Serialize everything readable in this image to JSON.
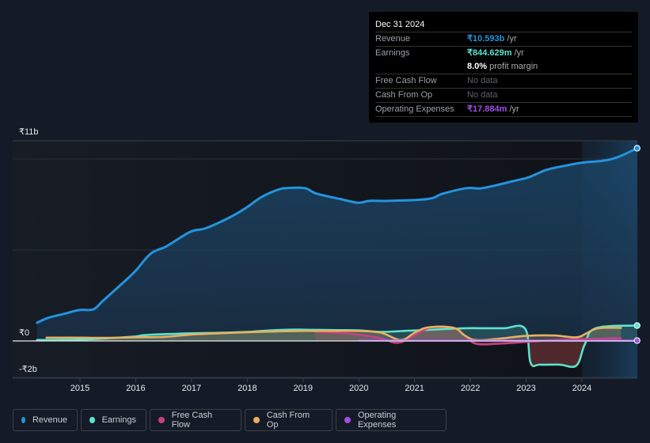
{
  "tooltip": {
    "date": "Dec 31 2024",
    "rows": [
      {
        "label": "Revenue",
        "value": "₹10.593b",
        "unit": " /yr",
        "color": "#2394df"
      },
      {
        "label": "Earnings",
        "value": "₹844.629m",
        "unit": " /yr",
        "color": "#5ce3cc"
      },
      {
        "label": "",
        "value": "8.0%",
        "unit": " profit margin",
        "color": "#ffffff"
      },
      {
        "label": "Free Cash Flow",
        "value": "No data",
        "unit": "",
        "color": ""
      },
      {
        "label": "Cash From Op",
        "value": "No data",
        "unit": "",
        "color": ""
      },
      {
        "label": "Operating Expenses",
        "value": "₹17.884m",
        "unit": " /yr",
        "color": "#a34ee6"
      }
    ]
  },
  "legend": [
    {
      "label": "Revenue",
      "color": "#2394df"
    },
    {
      "label": "Earnings",
      "color": "#5ce3cc"
    },
    {
      "label": "Free Cash Flow",
      "color": "#c2447f"
    },
    {
      "label": "Cash From Op",
      "color": "#e8b060"
    },
    {
      "label": "Operating Expenses",
      "color": "#a34ee6"
    }
  ],
  "chart_data": {
    "type": "line",
    "title": "",
    "xlabel": "",
    "ylabel": "",
    "currency": "₹",
    "ylim": [
      -2,
      11
    ],
    "xlim": [
      2014.2,
      2025.0
    ],
    "y_ticks": [
      {
        "value": 11,
        "label": "₹11b"
      },
      {
        "value": 0,
        "label": "₹0"
      },
      {
        "value": -2,
        "label": "-₹2b"
      }
    ],
    "gridlines": [
      11,
      10,
      5,
      0,
      -2
    ],
    "x_ticks": [
      2015,
      2016,
      2017,
      2018,
      2019,
      2020,
      2021,
      2022,
      2023,
      2024
    ],
    "highlight_start": 2024.0,
    "grid": true,
    "legend_position": "bottom",
    "units": "billions",
    "series": [
      {
        "name": "Revenue",
        "color": "#2394df",
        "fill": true,
        "x": [
          2014.23,
          2014.42,
          2014.7,
          2014.99,
          2015.24,
          2015.41,
          2015.7,
          2015.98,
          2016.27,
          2016.55,
          2016.98,
          2017.26,
          2017.69,
          2017.97,
          2018.25,
          2018.54,
          2018.71,
          2019.03,
          2019.24,
          2019.67,
          2019.98,
          2020.2,
          2020.52,
          2021.23,
          2021.51,
          2021.94,
          2022.22,
          2022.79,
          2023.05,
          2023.36,
          2023.65,
          2024.0,
          2024.36,
          2024.64,
          2024.99
        ],
        "y": [
          1.0,
          1.26,
          1.48,
          1.7,
          1.74,
          2.2,
          3.0,
          3.8,
          4.8,
          5.2,
          6.0,
          6.2,
          6.8,
          7.3,
          7.9,
          8.3,
          8.4,
          8.4,
          8.1,
          7.8,
          7.6,
          7.7,
          7.7,
          7.8,
          8.1,
          8.4,
          8.4,
          8.8,
          9.0,
          9.4,
          9.6,
          9.8,
          9.9,
          10.1,
          10.593
        ]
      },
      {
        "name": "Earnings",
        "color": "#5ce3cc",
        "fill": true,
        "x": [
          2014.23,
          2015.0,
          2015.5,
          2016.0,
          2016.2,
          2017.0,
          2017.5,
          2018.0,
          2018.3,
          2018.7,
          2019.0,
          2019.5,
          2020.0,
          2020.4,
          2020.8,
          2021.2,
          2021.5,
          2021.9,
          2022.2,
          2022.6,
          2022.98,
          2023.08,
          2023.25,
          2023.6,
          2023.9,
          2024.05,
          2024.25,
          2024.99
        ],
        "y": [
          0.05,
          0.08,
          0.15,
          0.25,
          0.33,
          0.42,
          0.45,
          0.5,
          0.56,
          0.62,
          0.62,
          0.6,
          0.58,
          0.5,
          0.55,
          0.6,
          0.65,
          0.7,
          0.7,
          0.7,
          0.68,
          -1.2,
          -1.3,
          -1.3,
          -1.35,
          -0.2,
          0.7,
          0.845
        ]
      },
      {
        "name": "Free Cash Flow",
        "color": "#c2447f",
        "fill": true,
        "x": [
          2019.22,
          2019.6,
          2020.0,
          2020.4,
          2020.7,
          2021.0,
          2021.3,
          2021.7,
          2021.9,
          2022.1,
          2022.5,
          2023.0,
          2023.5,
          2024.0,
          2024.3,
          2024.7
        ],
        "y": [
          0.5,
          0.45,
          0.35,
          0.15,
          -0.1,
          0.3,
          0.75,
          0.72,
          0.3,
          -0.15,
          -0.15,
          -0.05,
          0.05,
          0.1,
          0.12,
          0.15
        ]
      },
      {
        "name": "Cash From Op",
        "color": "#e8b060",
        "fill": true,
        "x": [
          2014.4,
          2015.0,
          2015.5,
          2016.0,
          2016.5,
          2017.0,
          2017.5,
          2018.0,
          2018.5,
          2019.0,
          2019.5,
          2020.0,
          2020.4,
          2020.75,
          2021.0,
          2021.25,
          2021.7,
          2021.9,
          2022.1,
          2022.5,
          2023.0,
          2023.5,
          2023.9,
          2024.1,
          2024.3,
          2024.7
        ],
        "y": [
          0.18,
          0.18,
          0.17,
          0.2,
          0.22,
          0.35,
          0.42,
          0.48,
          0.52,
          0.55,
          0.55,
          0.55,
          0.45,
          0.05,
          0.45,
          0.75,
          0.72,
          0.3,
          0.05,
          0.12,
          0.28,
          0.3,
          0.2,
          0.45,
          0.7,
          0.72
        ]
      },
      {
        "name": "Operating Expenses",
        "color": "#a34ee6",
        "fill": false,
        "x": [
          2020.0,
          2021.0,
          2022.0,
          2023.0,
          2024.0,
          2024.99
        ],
        "y": [
          0.03,
          0.02,
          0.02,
          0.02,
          0.02,
          0.018
        ]
      }
    ]
  }
}
